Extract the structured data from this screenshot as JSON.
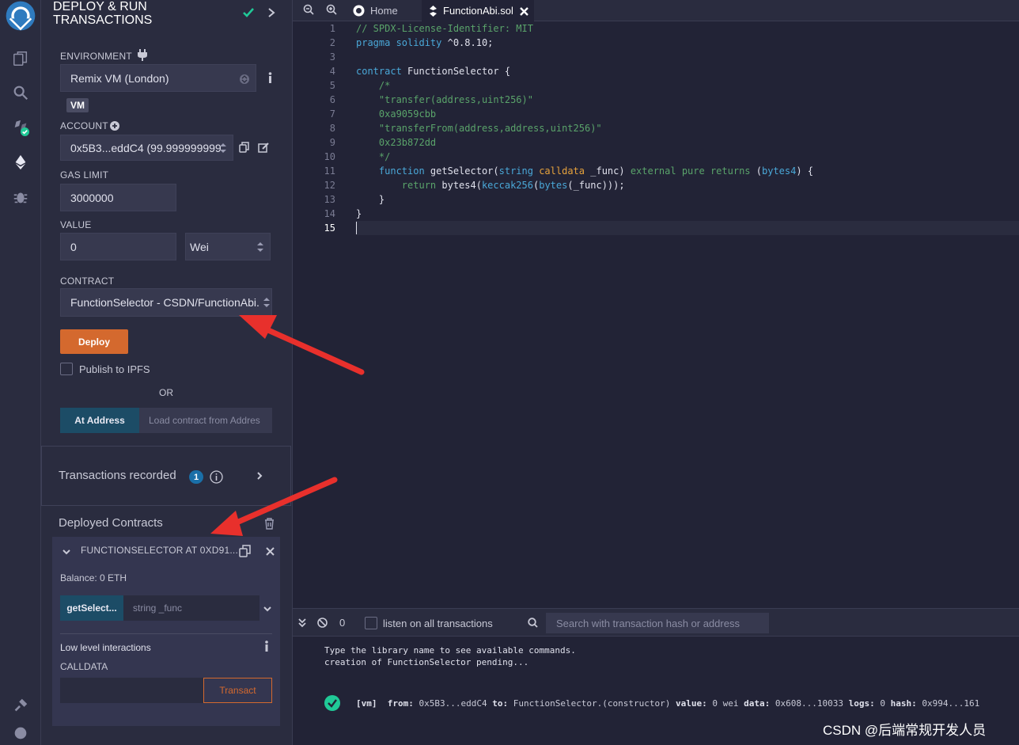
{
  "colors": {
    "accent_orange": "#d4692e",
    "accent_blue": "#1c4c66",
    "success_green": "#20c997",
    "annotation_red": "#e8302c"
  },
  "rail": {
    "icons": [
      "remix-logo-icon",
      "file-explorer-icon",
      "search-icon",
      "solidity-compiler-icon",
      "deploy-run-icon",
      "debugger-icon",
      "plugin-manager-icon",
      "settings-icon"
    ]
  },
  "panel": {
    "title_line1": "DEPLOY & RUN",
    "title_line2": "TRANSACTIONS",
    "environment_label": "ENVIRONMENT",
    "environment_value": "Remix VM (London)",
    "vm_badge": "VM",
    "account_label": "ACCOUNT",
    "account_value": "0x5B3...eddC4 (99.999999999",
    "gas_limit_label": "GAS LIMIT",
    "gas_limit_value": "3000000",
    "value_label": "VALUE",
    "value_amount": "0",
    "value_unit": "Wei",
    "contract_label": "CONTRACT",
    "contract_value": "FunctionSelector - CSDN/FunctionAbi.",
    "deploy_button": "Deploy",
    "publish_ipfs": "Publish to IPFS",
    "or_text": "OR",
    "at_address_button": "At Address",
    "load_contract_placeholder": "Load contract from Addres",
    "transactions_recorded": "Transactions recorded",
    "transactions_count": "1",
    "deployed_contracts": "Deployed Contracts",
    "instance": {
      "name": "FUNCTIONSELECTOR AT 0XD91...",
      "balance": "Balance: 0 ETH",
      "function_button": "getSelect...",
      "function_input_placeholder": "string _func",
      "low_level": "Low level interactions",
      "calldata_label": "CALLDATA",
      "transact_button": "Transact"
    }
  },
  "tabs": {
    "home": "Home",
    "file": "FunctionAbi.sol"
  },
  "editor": {
    "line_numbers": [
      "1",
      "2",
      "3",
      "4",
      "5",
      "6",
      "7",
      "8",
      "9",
      "10",
      "11",
      "12",
      "13",
      "14",
      "15"
    ],
    "active_line": "15",
    "lines": {
      "l1": "// SPDX-License-Identifier: MIT",
      "l2_kw": "pragma solidity",
      "l2_ver": " ^0.8.10;",
      "l4_kw": "contract",
      "l4_rest": " FunctionSelector {",
      "l5": "    /*",
      "l6": "    \"transfer(address,uint256)\"",
      "l7": "    0xa9059cbb",
      "l8": "    \"transferFrom(address,address,uint256)\"",
      "l9": "    0x23b872dd",
      "l10": "    */",
      "l11_a": "    function",
      "l11_b": " getSelector(",
      "l11_c": "string",
      "l11_d": " calldata",
      "l11_e": " _func) ",
      "l11_f": "external pure returns",
      "l11_g": " (",
      "l11_h": "bytes4",
      "l11_i": ") {",
      "l12_a": "        return",
      "l12_b": " bytes4(",
      "l12_c": "keccak256",
      "l12_d": "(",
      "l12_e": "bytes",
      "l12_f": "(_func)));",
      "l13": "    }",
      "l14": "}"
    }
  },
  "terminal": {
    "pending_count": "0",
    "listen_label": "listen on all transactions",
    "search_placeholder": "Search with transaction hash or address",
    "line1": "Type the library name to see available commands.",
    "line2": "creation of FunctionSelector pending...",
    "log": {
      "vm": "[vm]",
      "from_label": "from:",
      "from": "0x5B3...eddC4",
      "to_label": "to:",
      "to": "FunctionSelector.(constructor)",
      "value_label": "value:",
      "value": "0 wei",
      "data_label": "data:",
      "data": "0x608...10033",
      "logs_label": "logs:",
      "logs": "0",
      "hash_label": "hash:",
      "hash": "0x994...161"
    }
  },
  "watermark": "CSDN @后端常规开发人员"
}
